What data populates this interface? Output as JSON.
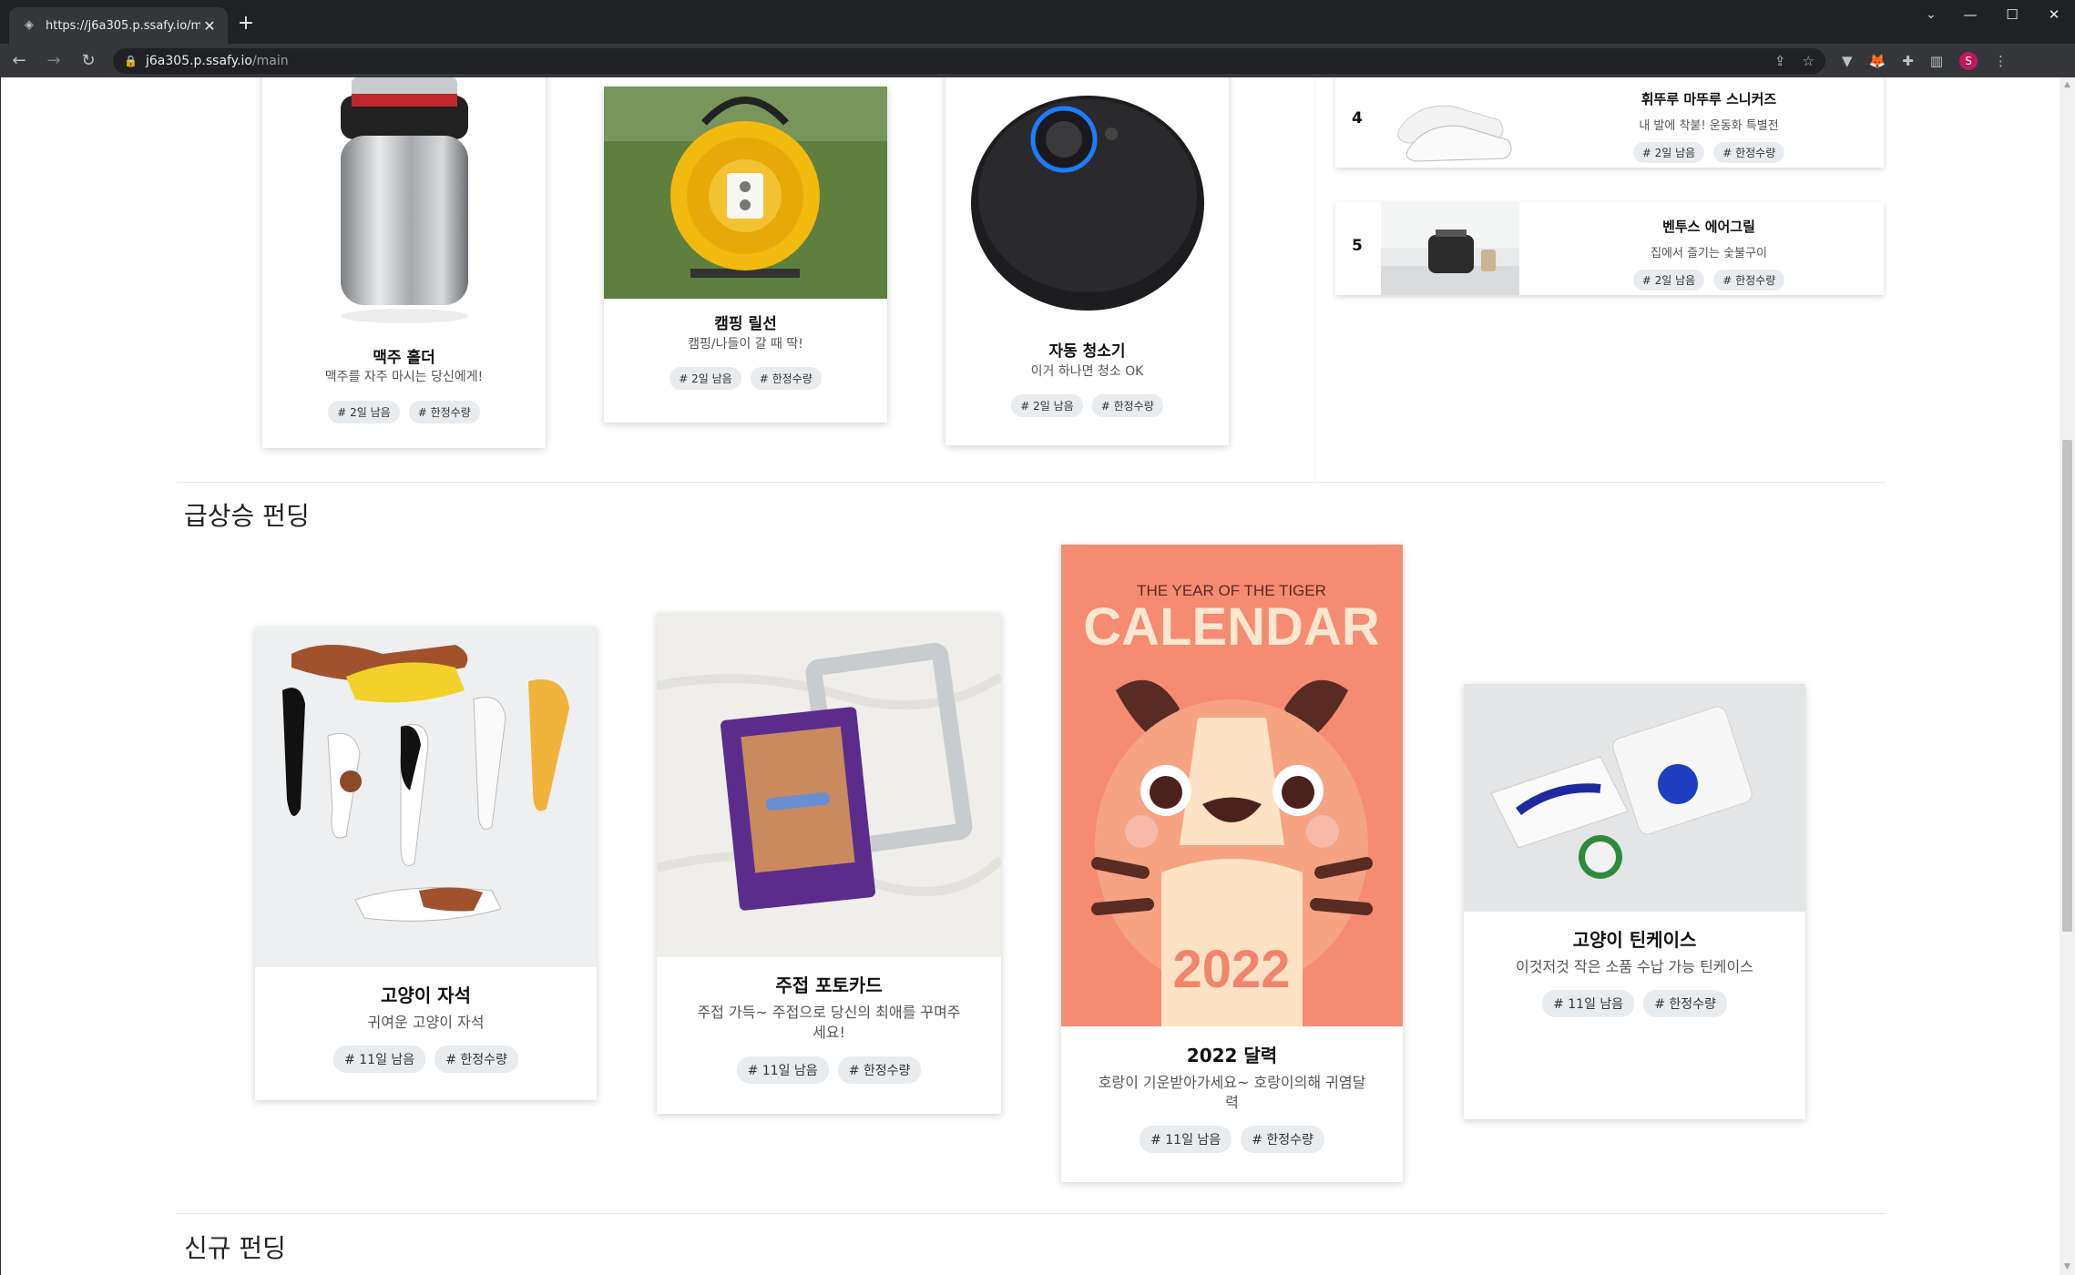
{
  "browser": {
    "tab_title": "https://j6a305.p.ssafy.io/main",
    "url_host": "j6a305.p.ssafy.io",
    "url_path": "/main",
    "profile_initial": "S"
  },
  "chip_colors": {
    "background": "#e9ecef",
    "text": "#333333"
  },
  "top_products": [
    {
      "title": "맥주 홀더",
      "desc": "맥주를 자주 마시는 당신에게!",
      "chips": [
        "# 2일 남음",
        "# 한정수량"
      ]
    },
    {
      "title": "캠핑 릴선",
      "desc": "캠핑/나들이 갈 때 딱!",
      "chips": [
        "# 2일 남음",
        "# 한정수량"
      ]
    },
    {
      "title": "자동 청소기",
      "desc": "이거 하나면 청소 OK",
      "chips": [
        "# 2일 남음",
        "# 한정수량"
      ]
    }
  ],
  "ranking": [
    {
      "rank": "4",
      "title": "휘뚜루 마뚜루 스니커즈",
      "desc": "내 발에 착붙! 운동화 특별전",
      "chips": [
        "# 2일 남음",
        "# 한정수량"
      ]
    },
    {
      "rank": "5",
      "title": "벤투스 에어그릴",
      "desc": "집에서 즐기는 숯불구이",
      "chips": [
        "# 2일 남음",
        "# 한정수량"
      ]
    }
  ],
  "rising": {
    "section_title": "급상승 펀딩",
    "products": [
      {
        "title": "고양이 자석",
        "desc": "귀여운 고양이 자석",
        "chips": [
          "# 11일 남음",
          "# 한정수량"
        ]
      },
      {
        "title": "주접 포토카드",
        "desc": "주접 가득~ 주접으로 당신의 최애를 꾸며주세요!",
        "chips": [
          "# 11일 남음",
          "# 한정수량"
        ]
      },
      {
        "title": "2022 달력",
        "desc": "호랑이 기운받아가세요~ 호랑이의해 귀염달력",
        "chips": [
          "# 11일 남음",
          "# 한정수량"
        ],
        "poster_line1": "THE YEAR OF THE TIGER",
        "poster_line2": "CALENDAR",
        "poster_year": "2022"
      },
      {
        "title": "고양이 틴케이스",
        "desc": "이것저것 작은 소품 수납 가능 틴케이스",
        "chips": [
          "# 11일 남음",
          "# 한정수량"
        ]
      }
    ]
  },
  "new": {
    "section_title": "신규 펀딩"
  }
}
